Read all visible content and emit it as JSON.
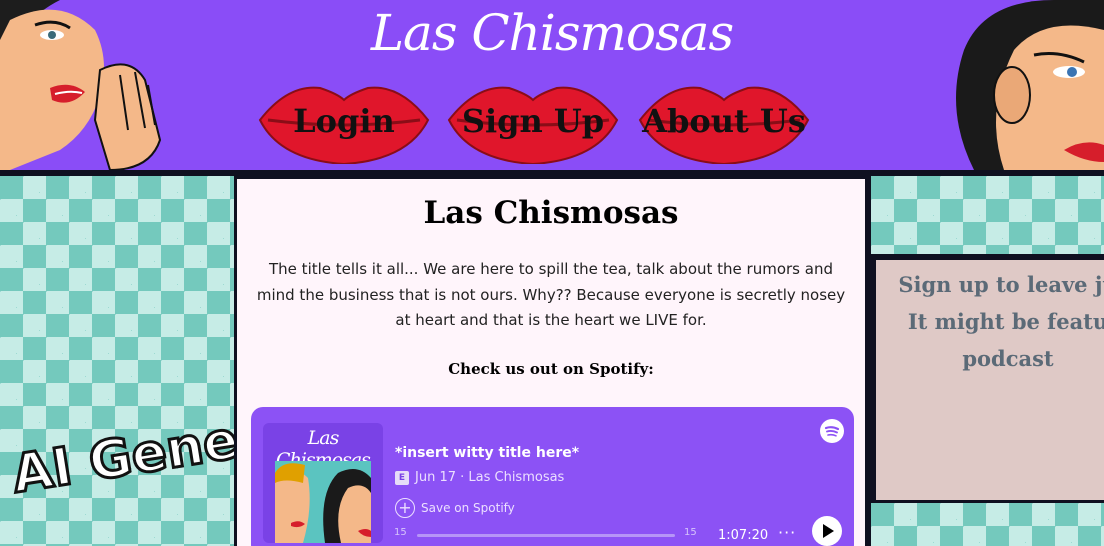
{
  "header": {
    "title": "Las Chismosas",
    "nav": [
      {
        "label": "Login"
      },
      {
        "label": "Sign Up"
      },
      {
        "label": "About Us"
      }
    ]
  },
  "sidebar_left": {
    "banner": "AI Gene"
  },
  "sidebar_right": {
    "lines": [
      "Sign up to leave ju",
      "It might be featu",
      "podcast"
    ]
  },
  "main": {
    "heading": "Las Chismosas",
    "intro": "The title tells it all... We are here to spill the tea, talk about the rumors and mind the business that is not ours. Why?? Because everyone is secretly nosey at heart and that is the heart we LIVE for.",
    "spotify_cta": "Check us out on Spotify:"
  },
  "player": {
    "cover_title": "Las Chismosas",
    "episode_title": "*insert witty title here*",
    "explicit_badge": "E",
    "meta": "Jun 17 · Las Chismosas",
    "save_label": "Save on Spotify",
    "rewind_label": "15",
    "forward_label": "15",
    "duration": "1:07:20",
    "more_label": "···"
  },
  "colors": {
    "header_bg": "#8a4df7",
    "lips": "#e0162b",
    "pattern_teal": "#74c9bd",
    "main_bg": "#fff5fb",
    "player_bg": "#8c52f5",
    "right_box": "#dfc9c6"
  }
}
